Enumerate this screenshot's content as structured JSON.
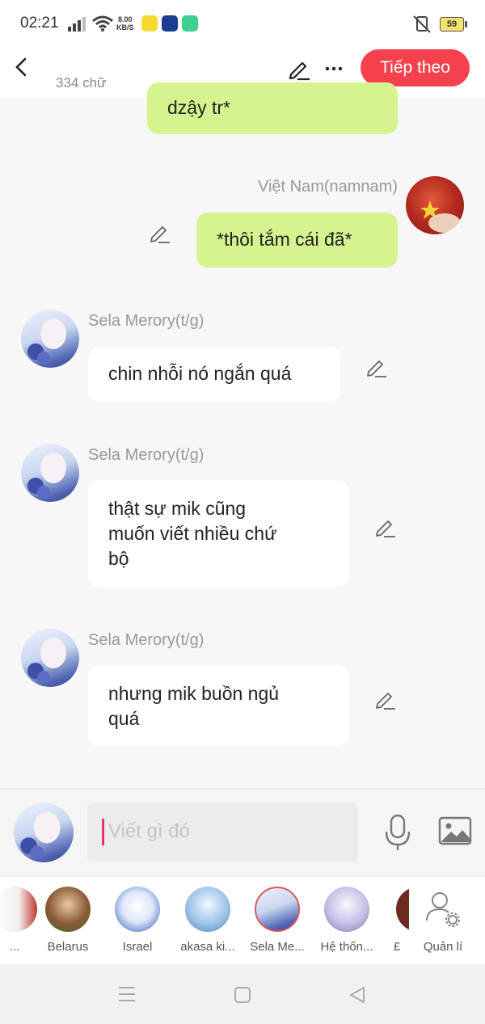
{
  "status": {
    "time": "02:21",
    "net_speed_value": "8.00",
    "net_speed_unit": "KB/S",
    "battery": "59"
  },
  "header": {
    "word_count": "334 chữ",
    "next_label": "Tiếp theo"
  },
  "messages": [
    {
      "sender": "",
      "text": "dzậy tr*",
      "side": "right"
    },
    {
      "sender": "Việt Nam(namnam)",
      "text": "*thôi tắm cái đã*",
      "side": "right"
    },
    {
      "sender": "Sela Merory(t/g)",
      "text": "chin nhỗi nó ngắn quá",
      "side": "left"
    },
    {
      "sender": "Sela Merory(t/g)",
      "line1": "thật sự mik cũng",
      "line2": "muốn viết nhiều chứ",
      "line3": "bộ",
      "side": "left"
    },
    {
      "sender": "Sela Merory(t/g)",
      "line1": "nhưng mik buồn ngủ",
      "line2": "quá",
      "side": "left"
    }
  ],
  "composer": {
    "placeholder": "Viết gì đó"
  },
  "characters": [
    {
      "name": "..."
    },
    {
      "name": "Belarus"
    },
    {
      "name": "Israel"
    },
    {
      "name": "akasa ki..."
    },
    {
      "name": "Sela Me..."
    },
    {
      "name": "Hệ thốn..."
    },
    {
      "name": "£"
    },
    {
      "name": "Quản lí"
    }
  ],
  "colors": {
    "accent": "#f5414e",
    "own_bubble": "#d5f48f",
    "other_bubble": "#ffffff",
    "caret": "#e8316f"
  },
  "icons": [
    "signal-icon",
    "wifi-icon",
    "mute-icon",
    "back-icon",
    "pencil-icon",
    "more-icon",
    "edit-icon",
    "microphone-icon",
    "image-icon",
    "manage-user-icon",
    "menu-icon",
    "home-icon",
    "back-triangle-icon"
  ]
}
